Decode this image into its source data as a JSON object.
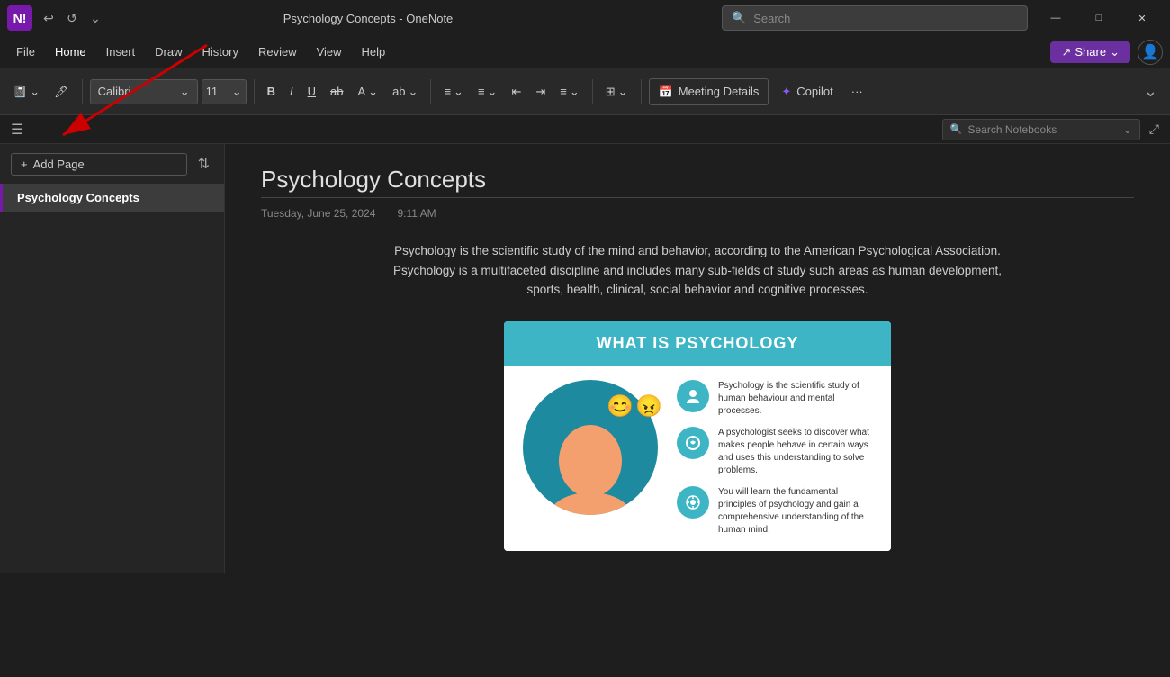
{
  "app": {
    "logo": "N!",
    "title": "Psychology Concepts - OneNote",
    "window_controls": {
      "minimize": "—",
      "maximize": "□",
      "close": "✕"
    }
  },
  "titlebar": {
    "back_icon": "↩",
    "forward_icon": "↩",
    "undo_icon": "↩",
    "quick_access_icon": "⌄"
  },
  "search": {
    "placeholder": "Search"
  },
  "menu": {
    "items": [
      "File",
      "Home",
      "Insert",
      "Draw",
      "History",
      "Review",
      "View",
      "Help"
    ],
    "active": "Home",
    "share_label": "Share",
    "profile_icon": "👤"
  },
  "ribbon": {
    "notebook_icon": "📓",
    "highlighter_icon": "🖊",
    "font_family": "Calibri",
    "font_size": "11",
    "bold": "B",
    "italic": "I",
    "underline": "U",
    "strikethrough": "ab",
    "font_color": "A",
    "highlight": "ab",
    "bullets": "≡",
    "numbering": "≡",
    "indent_dec": "←",
    "indent_inc": "→",
    "align": "≡",
    "more_formatting": "⊞",
    "meeting_details": "Meeting Details",
    "copilot": "Copilot",
    "more": "···",
    "expand": "⌄"
  },
  "sub_toolbar": {
    "hamburger": "☰",
    "search_notebooks_placeholder": "Search Notebooks",
    "expand": "⤢"
  },
  "sidebar": {
    "add_page_label": "Add Page",
    "sort_icon": "⇅",
    "pages": [
      {
        "id": "psychology-concepts",
        "label": "Psychology Concepts",
        "active": true
      }
    ]
  },
  "note": {
    "title": "Psychology Concepts",
    "date": "Tuesday, June 25, 2024",
    "time": "9:11 AM",
    "body": "Psychology is the scientific study of the mind and behavior, according to the American Psychological Association. Psychology is a multifaceted discipline and includes many sub-fields of study such areas as human development, sports, health, clinical, social behavior and cognitive processes.",
    "infographic": {
      "header": "WHAT IS PSYCHOLOGY",
      "header_bg": "#3db5c4",
      "text1_title": "",
      "text1": "Psychology is the scientific study of human behaviour and mental processes.",
      "text2": "A psychologist seeks to discover what makes people behave in certain ways and uses this understanding to solve problems.",
      "text3": "You will learn the fundamental principles of psychology and gain a comprehensive understanding of the human mind."
    }
  }
}
